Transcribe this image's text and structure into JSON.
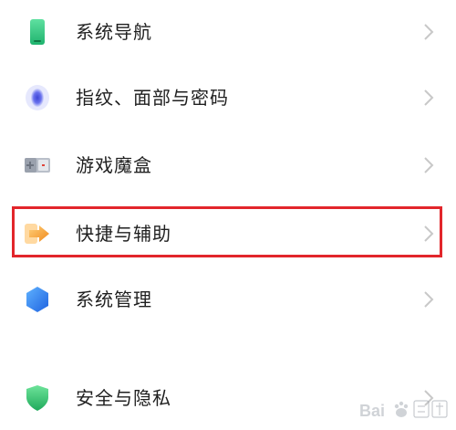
{
  "settings_list": {
    "items": [
      {
        "label": "系统导航",
        "icon": "phone-icon"
      },
      {
        "label": "指纹、面部与密码",
        "icon": "fingerprint-icon"
      },
      {
        "label": "游戏魔盒",
        "icon": "game-box-icon"
      },
      {
        "label": "快捷与辅助",
        "icon": "shortcut-arrow-icon"
      },
      {
        "label": "系统管理",
        "icon": "hexagon-icon"
      },
      {
        "label": "安全与隐私",
        "icon": "shield-icon"
      }
    ],
    "highlighted_item": "快捷与辅助"
  },
  "watermark": {
    "text": "Baidu经验"
  },
  "colors": {
    "highlight_border": "#e2262b",
    "label_text": "#1f1f1f",
    "chevron": "#c8c8c8"
  }
}
